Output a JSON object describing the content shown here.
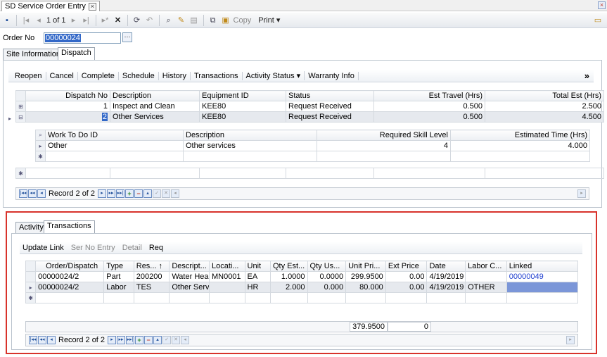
{
  "window": {
    "tab_title": "SD Service Order Entry"
  },
  "toolbar": {
    "record_text": "1 of 1",
    "copy_label": "Copy",
    "print_label": "Print ▾"
  },
  "header": {
    "order_label": "Order No",
    "order_value": "00000024"
  },
  "main_tabs": [
    "Site Information",
    "Dispatch"
  ],
  "dispatch": {
    "commands": [
      "Reopen",
      "Cancel",
      "Complete",
      "Schedule",
      "History",
      "Transactions",
      "Activity Status ▾",
      "Warranty Info"
    ],
    "more": "»",
    "columns": [
      "Dispatch No",
      "Description",
      "Equipment ID",
      "Status",
      "Est Travel (Hrs)",
      "Total Est (Hrs)"
    ],
    "rows": [
      [
        "1",
        "Inspect and Clean",
        "KEE80",
        "Request Received",
        "0.500",
        "2.500"
      ],
      [
        "2",
        "Other Services",
        "KEE80",
        "Request Received",
        "0.500",
        "4.500"
      ]
    ],
    "sub_columns": [
      "Work To Do ID",
      "Description",
      "Required Skill Level",
      "Estimated Time (Hrs)"
    ],
    "sub_rows": [
      [
        "Other",
        "Other services",
        "4",
        "4.000"
      ]
    ],
    "record_text": "Record 2 of 2"
  },
  "lower": {
    "tabs": [
      "Activity",
      "Transactions"
    ],
    "commands": [
      "Update Link",
      "Ser No Entry",
      "Detail",
      "Req"
    ],
    "columns": [
      "Order/Dispatch",
      "Type",
      "Res... ↑",
      "Descript...",
      "Locati...",
      "Unit",
      "Qty Est...",
      "Qty Us...",
      "Unit Pri...",
      "Ext Price",
      "Date",
      "Labor C...",
      "Linked"
    ],
    "rows": [
      [
        "00000024/2",
        "Part",
        "200200",
        "Water Hea...",
        "MN0001",
        "EA",
        "1.0000",
        "0.0000",
        "299.9500",
        "0.00",
        "4/19/2019",
        "",
        "00000049"
      ],
      [
        "00000024/2",
        "Labor",
        "TES",
        "Other Servi...",
        "",
        "HR",
        "2.000",
        "0.000",
        "80.000",
        "0.00",
        "4/19/2019",
        "OTHER",
        ""
      ]
    ],
    "totals": {
      "unit_price": "379.9500",
      "ext_price": "0"
    },
    "record_text": "Record 2 of 2"
  }
}
